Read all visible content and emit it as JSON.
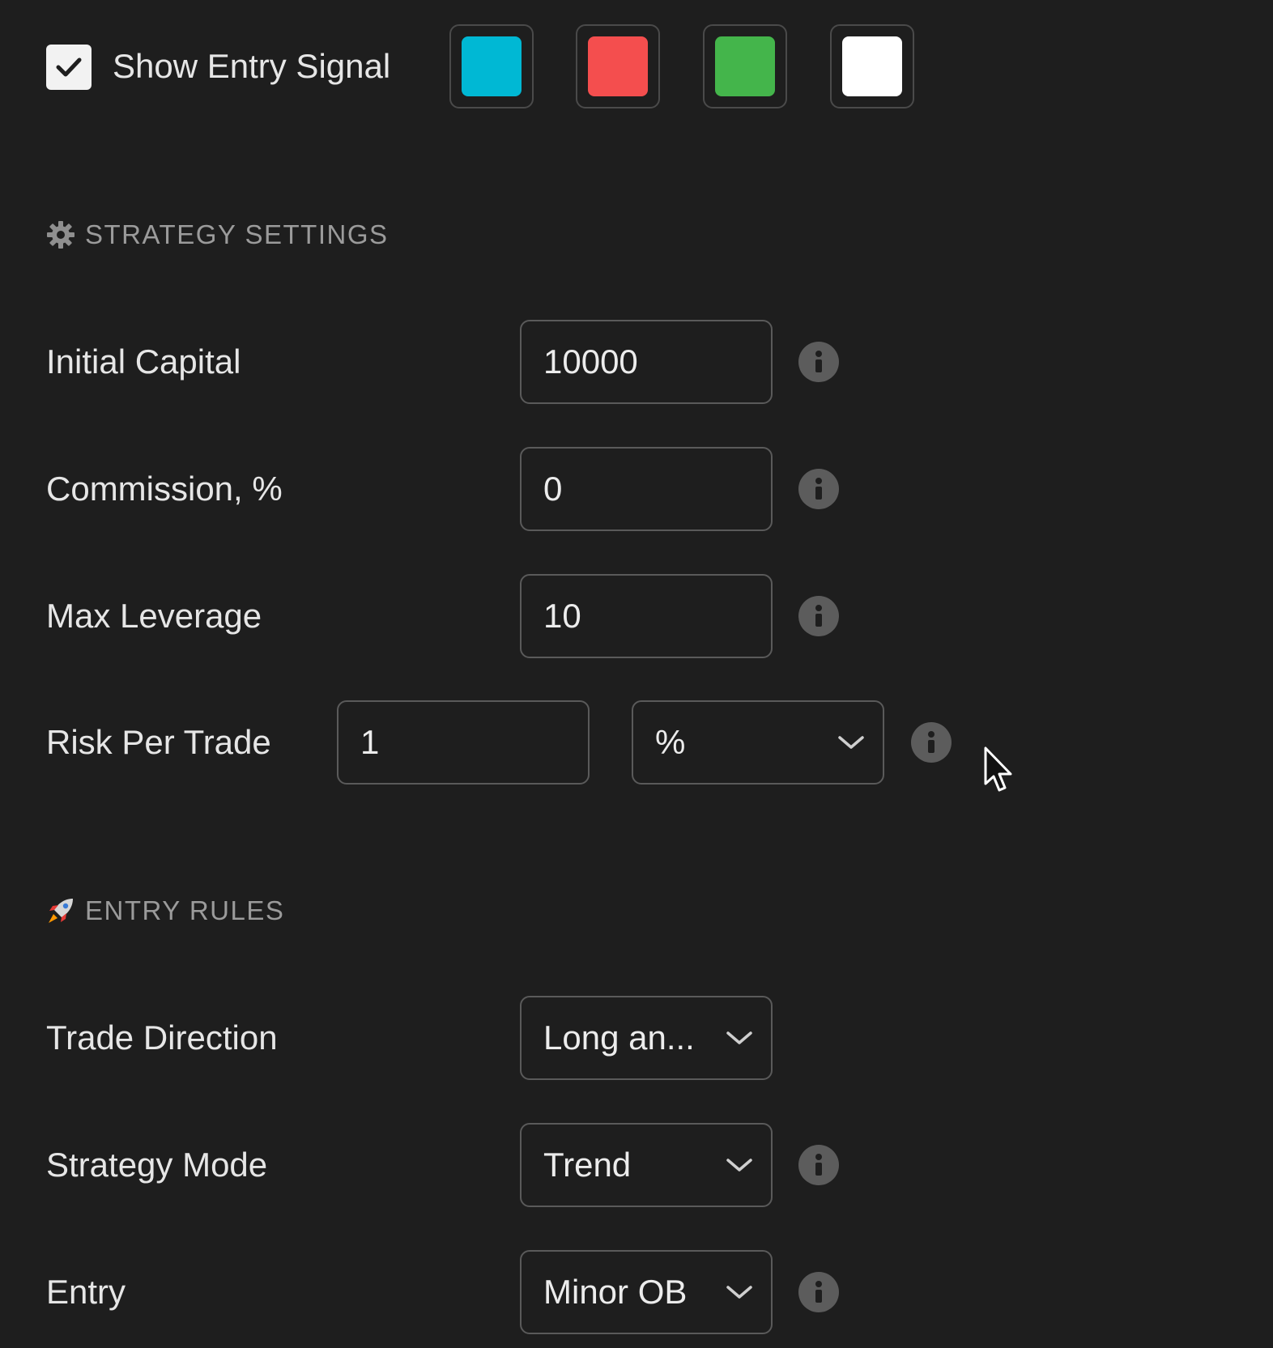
{
  "entry_signal": {
    "checked": true,
    "label": "Show Entry Signal",
    "colors": [
      "#00b8d4",
      "#f44e4e",
      "#44b54b",
      "#ffffff"
    ]
  },
  "strategy_settings": {
    "title": "STRATEGY SETTINGS",
    "icon": "gear-icon",
    "initial_capital": {
      "label": "Initial Capital",
      "value": "10000"
    },
    "commission": {
      "label": "Commission, %",
      "value": "0"
    },
    "max_leverage": {
      "label": "Max Leverage",
      "value": "10"
    },
    "risk_per_trade": {
      "label": "Risk Per Trade",
      "value": "1",
      "unit": "%"
    }
  },
  "entry_rules": {
    "title": "ENTRY RULES",
    "icon": "rocket-icon",
    "trade_direction": {
      "label": "Trade Direction",
      "value": "Long an..."
    },
    "strategy_mode": {
      "label": "Strategy Mode",
      "value": "Trend"
    },
    "entry": {
      "label": "Entry",
      "value": "Minor OB"
    }
  }
}
